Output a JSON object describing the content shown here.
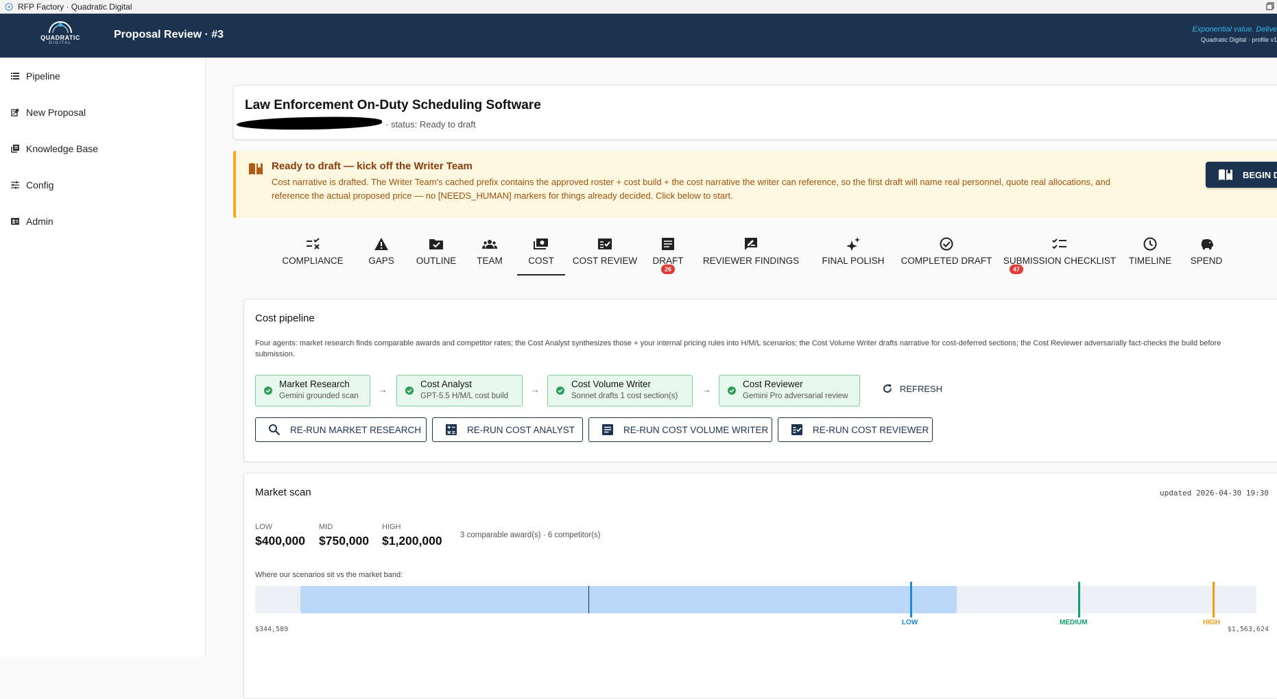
{
  "window": {
    "title": "RFP Factory · Quadratic Digital"
  },
  "header": {
    "logo_text": "QUADRATIC",
    "logo_sub": "DIGITAL",
    "title": "Proposal Review · #3",
    "tagline": "Exponential value. Delive",
    "profile": "Quadratic Digital · profile v1"
  },
  "sidebar": {
    "items": [
      {
        "label": "Pipeline",
        "icon": "list-icon"
      },
      {
        "label": "New Proposal",
        "icon": "new-proposal-icon"
      },
      {
        "label": "Knowledge Base",
        "icon": "library-icon"
      },
      {
        "label": "Config",
        "icon": "tune-icon"
      },
      {
        "label": "Admin",
        "icon": "admin-icon"
      }
    ]
  },
  "proposal": {
    "title": "Law Enforcement On-Duty Scheduling Software",
    "status_line": "· status: Ready to draft"
  },
  "banner": {
    "title": "Ready to draft — kick off the Writer Team",
    "body": "Cost narrative is drafted. The Writer Team's cached prefix contains the approved roster + cost build + the cost narrative the writer can reference, so the first draft will name real personnel, quote real allocations, and reference the actual proposed price — no [NEEDS_HUMAN] markers for things already decided. Click below to start.",
    "button_label": "BEGIN DRAFTING",
    "accent_color": "#f5a623"
  },
  "tabs": [
    {
      "label": "COMPLIANCE",
      "icon": "checklist-x-icon"
    },
    {
      "label": "GAPS",
      "icon": "warning-icon"
    },
    {
      "label": "OUTLINE",
      "icon": "folder-check-icon"
    },
    {
      "label": "TEAM",
      "icon": "groups-icon"
    },
    {
      "label": "COST",
      "icon": "payments-icon",
      "active": true
    },
    {
      "label": "COST REVIEW",
      "icon": "fact-check-icon"
    },
    {
      "label": "DRAFT",
      "icon": "article-icon",
      "badge": "26"
    },
    {
      "label": "REVIEWER FINDINGS",
      "icon": "rate-review-icon"
    },
    {
      "label": "FINAL POLISH",
      "icon": "sparkle-icon"
    },
    {
      "label": "COMPLETED DRAFT",
      "icon": "check-circle-icon"
    },
    {
      "label": "SUBMISSION CHECKLIST",
      "icon": "checklist-icon",
      "badge": "47"
    },
    {
      "label": "TIMELINE",
      "icon": "clock-icon"
    },
    {
      "label": "SPEND",
      "icon": "piggy-bank-icon"
    }
  ],
  "pipeline": {
    "title": "Cost pipeline",
    "description": "Four agents: market research finds comparable awards and competitor rates; the Cost Analyst synthesizes those + your internal pricing rules into H/M/L scenarios; the Cost Volume Writer drafts narrative for cost-deferred sections; the Cost Reviewer adversarially fact-checks the build before submission.",
    "stages": [
      {
        "name": "Market Research",
        "sub": "Gemini grounded scan"
      },
      {
        "name": "Cost Analyst",
        "sub": "GPT-5.5 H/M/L cost build"
      },
      {
        "name": "Cost Volume Writer",
        "sub": "Sonnet drafts 1 cost section(s)"
      },
      {
        "name": "Cost Reviewer",
        "sub": "Gemini Pro adversarial review"
      }
    ],
    "arrow": "→",
    "refresh_label": "REFRESH",
    "rerun_buttons": [
      {
        "label": "RE-RUN MARKET RESEARCH",
        "icon": "search-icon"
      },
      {
        "label": "RE-RUN COST ANALYST",
        "icon": "calculator-icon"
      },
      {
        "label": "RE-RUN COST VOLUME WRITER",
        "icon": "article-icon"
      },
      {
        "label": "RE-RUN COST REVIEWER",
        "icon": "fact-check-icon"
      }
    ],
    "status_color": "#2e9e5b"
  },
  "market": {
    "title": "Market scan",
    "updated": "updated 2026-04-30 19:30",
    "band": [
      {
        "label": "LOW",
        "value": "$400,000"
      },
      {
        "label": "MID",
        "value": "$750,000"
      },
      {
        "label": "HIGH",
        "value": "$1,200,000"
      }
    ],
    "comparables": "3 comparable award(s) · 6 competitor(s)",
    "scenario_label": "Where our scenarios sit vs the market band:",
    "axis_min_label": "$344,589",
    "axis_max_label": "$1,563,624",
    "scenarios": [
      {
        "label": "LOW",
        "color": "#1e88e5"
      },
      {
        "label": "MEDIUM",
        "color": "#12a170"
      },
      {
        "label": "HIGH",
        "color": "#f39c12"
      }
    ]
  }
}
